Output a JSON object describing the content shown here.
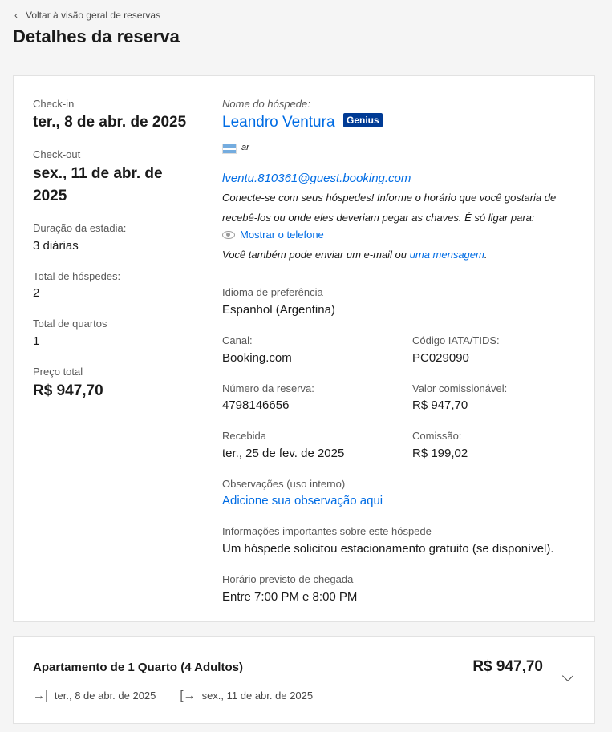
{
  "nav": {
    "back_label": "Voltar à visão geral de reservas"
  },
  "page": {
    "title": "Detalhes da reserva"
  },
  "left": {
    "checkin_label": "Check-in",
    "checkin_value": "ter., 8 de abr. de 2025",
    "checkout_label": "Check-out",
    "checkout_value_line1": "sex., 11 de abr. de",
    "checkout_value_line2": "2025",
    "duration_label": "Duração da estadia:",
    "duration_value": "3 diárias",
    "guests_label": "Total de hóspedes:",
    "guests_value": "2",
    "rooms_label": "Total de quartos",
    "rooms_value": "1",
    "price_label": "Preço total",
    "price_value": "R$ 947,70"
  },
  "guest": {
    "name_label": "Nome do hóspede:",
    "name": "Leandro Ventura",
    "badge": "Genius",
    "country": "ar",
    "email": "lventu.810361@guest.booking.com",
    "contact_line1": "Conecte-se com seus hóspedes! Informe o horário que você gostaria de",
    "contact_line2": "recebê-los ou onde eles deveriam pegar as chaves. É só ligar para:",
    "show_phone": "Mostrar o telefone",
    "email_note_prefix": "Você também pode enviar um e-mail ou ",
    "email_note_link": "uma mensagem",
    "email_note_suffix": "."
  },
  "details": {
    "language_label": "Idioma de preferência",
    "language_value": "Espanhol (Argentina)",
    "channel_label": "Canal:",
    "channel_value": "Booking.com",
    "iata_label": "Código IATA/TIDS:",
    "iata_value": "PC029090",
    "booking_number_label": "Número da reserva:",
    "booking_number_value": "4798146656",
    "commissionable_label": "Valor comissionável:",
    "commissionable_value": "R$ 947,70",
    "received_label": "Recebida",
    "received_value": "ter., 25 de fev. de 2025",
    "commission_label": "Comissão:",
    "commission_value": "R$ 199,02",
    "notes_label": "Observações (uso interno)",
    "notes_link": "Adicione sua observação aqui",
    "important_label": "Informações importantes sobre este hóspede",
    "important_value": "Um hóspede solicitou estacionamento gratuito (se disponível).",
    "arrival_label": "Horário previsto de chegada",
    "arrival_value": "Entre 7:00 PM e 8:00 PM"
  },
  "room": {
    "title": "Apartamento de 1 Quarto (4 Adultos)",
    "price": "R$ 947,70",
    "checkin": "ter., 8 de abr. de 2025",
    "checkout": "sex., 11 de abr. de 2025"
  },
  "colors": {
    "link": "#006ce4",
    "genius_badge": "#003b95"
  },
  "icons": [
    "chevron-left-icon",
    "eye-icon",
    "check-in-arrow-icon",
    "check-out-arrow-icon",
    "chevron-down-icon",
    "argentina-flag-icon"
  ]
}
